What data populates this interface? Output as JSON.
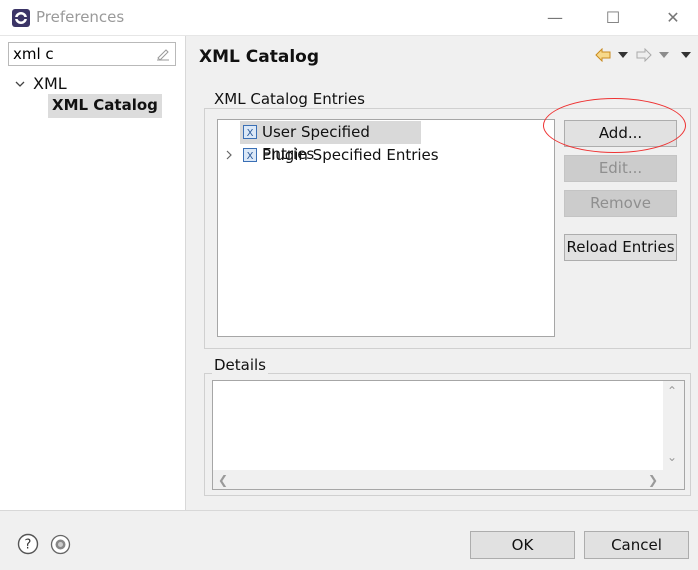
{
  "window": {
    "title": "Preferences"
  },
  "filter": {
    "value": "xml c"
  },
  "nav": {
    "items": [
      {
        "label": "XML",
        "expanded": true
      },
      {
        "label": "XML Catalog",
        "selected": true
      }
    ]
  },
  "page": {
    "title": "XML Catalog"
  },
  "entries_group": {
    "title": "XML Catalog Entries",
    "rows": [
      "User Specified Entries",
      "Plugin Specified Entries"
    ]
  },
  "buttons": {
    "add": "Add...",
    "edit": "Edit...",
    "remove": "Remove",
    "reload": "Reload Entries",
    "ok": "OK",
    "cancel": "Cancel"
  },
  "details_group": {
    "title": "Details"
  },
  "icons": {
    "app": "eclipse-icon",
    "nav_back": "back-arrow-icon",
    "nav_forward": "forward-arrow-icon",
    "help": "help-icon",
    "prefs": "preferences-icon",
    "catalog_entry": "xml-catalog-icon"
  },
  "colors": {
    "highlight": "#e33333",
    "selection": "#d9d9d9",
    "nav_back": "#e5a13c"
  }
}
